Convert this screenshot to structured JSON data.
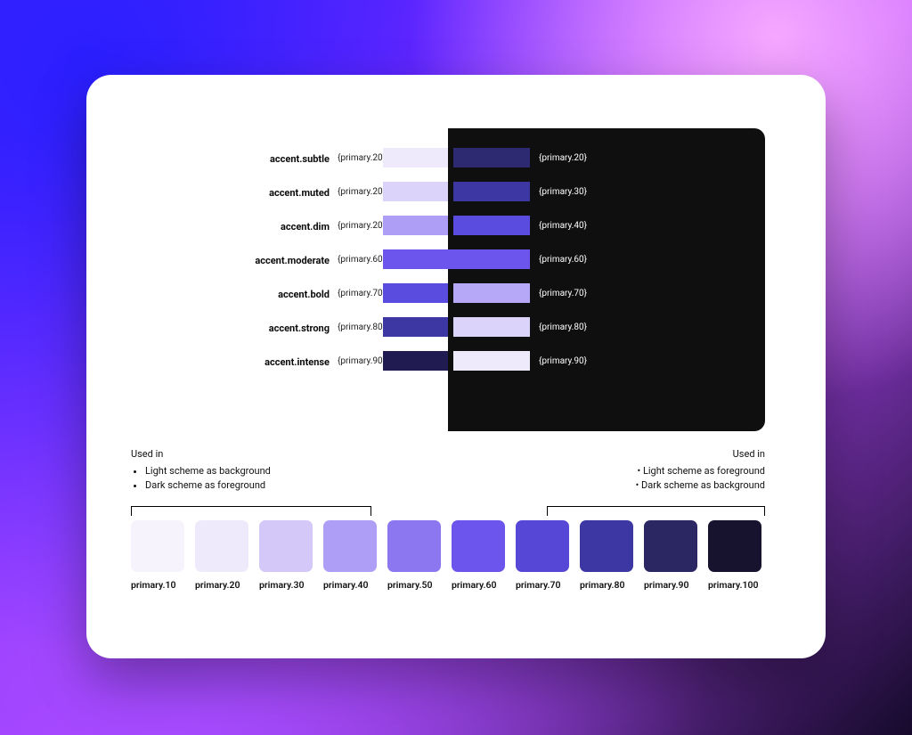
{
  "tokens": [
    {
      "name": "accent.subtle",
      "light_ref": "{primary.20}",
      "dark_ref": "{primary.20}",
      "light_color": "#EFEAFB",
      "dark_color": "#2E2A72"
    },
    {
      "name": "accent.muted",
      "light_ref": "{primary.20}",
      "dark_ref": "{primary.30}",
      "light_color": "#DCD3FA",
      "dark_color": "#3D37A3"
    },
    {
      "name": "accent.dim",
      "light_ref": "{primary.20}",
      "dark_ref": "{primary.40}",
      "light_color": "#AE9EF6",
      "dark_color": "#5A4CDF"
    },
    {
      "name": "accent.moderate",
      "light_ref": "{primary.60}",
      "dark_ref": "{primary.60}",
      "span": true,
      "span_color": "#6C55EC"
    },
    {
      "name": "accent.bold",
      "light_ref": "{primary.70}",
      "dark_ref": "{primary.70}",
      "light_color": "#5A4CDF",
      "dark_color": "#B7A8F7"
    },
    {
      "name": "accent.strong",
      "light_ref": "{primary.80}",
      "dark_ref": "{primary.80}",
      "light_color": "#3D37A3",
      "dark_color": "#DCD3FA"
    },
    {
      "name": "accent.intense",
      "light_ref": "{primary.90}",
      "dark_ref": "{primary.90}",
      "light_color": "#201C52",
      "dark_color": "#EFEAFB"
    }
  ],
  "notes": {
    "left": {
      "header": "Used in",
      "items": [
        "Light scheme as background",
        "Dark scheme as foreground"
      ]
    },
    "right": {
      "header": "Used in",
      "items": [
        "Light scheme as foreground",
        "Dark scheme as background"
      ]
    }
  },
  "palette": [
    {
      "label": "primary.10",
      "color": "#F6F3FD"
    },
    {
      "label": "primary.20",
      "color": "#EFEAFB"
    },
    {
      "label": "primary.30",
      "color": "#D4C8F9"
    },
    {
      "label": "primary.40",
      "color": "#AE9EF6"
    },
    {
      "label": "primary.50",
      "color": "#8C77F1"
    },
    {
      "label": "primary.60",
      "color": "#6C55EC"
    },
    {
      "label": "primary.70",
      "color": "#5747D6"
    },
    {
      "label": "primary.80",
      "color": "#3D37A3"
    },
    {
      "label": "primary.90",
      "color": "#2B2762"
    },
    {
      "label": "primary.100",
      "color": "#17132F"
    }
  ]
}
